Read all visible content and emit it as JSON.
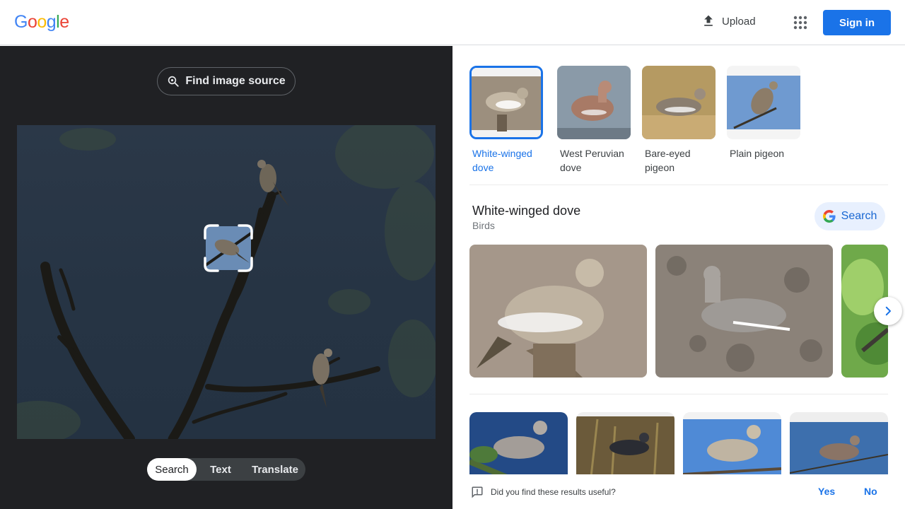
{
  "header": {
    "logo_letters": [
      "G",
      "o",
      "o",
      "g",
      "l",
      "e"
    ],
    "logo_colors": [
      "#4285f4",
      "#ea4335",
      "#fbbc05",
      "#4285f4",
      "#34a853",
      "#ea4335"
    ],
    "upload_label": "Upload",
    "apps_icon": "apps-grid-icon",
    "signin_label": "Sign in"
  },
  "left": {
    "find_source_label": "Find image source",
    "modes": [
      "Search",
      "Text",
      "Translate"
    ],
    "active_mode": "Search"
  },
  "right": {
    "matches": [
      {
        "label": "White-winged dove",
        "selected": true
      },
      {
        "label": "West Peruvian dove",
        "selected": false
      },
      {
        "label": "Bare-eyed pigeon",
        "selected": false
      },
      {
        "label": "Plain pigeon",
        "selected": false
      }
    ],
    "knowledge": {
      "title": "White-winged dove",
      "subtitle": "Birds",
      "search_label": "Search"
    },
    "feedback": {
      "question": "Did you find these results useful?",
      "yes": "Yes",
      "no": "No"
    }
  },
  "colors": {
    "accent": "#1a73e8",
    "left_bg": "#202124"
  }
}
